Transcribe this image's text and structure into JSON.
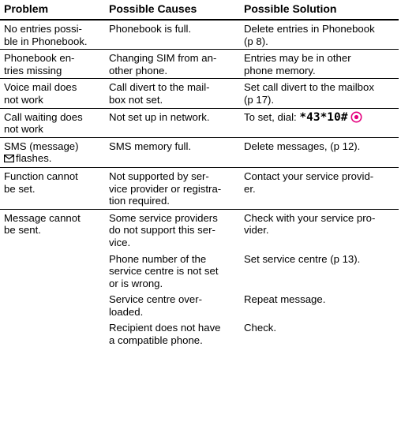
{
  "headers": {
    "problem": "Problem",
    "causes": "Possible Causes",
    "solution": "Possible Solution"
  },
  "rows": [
    {
      "problem": "No entries possi-\nble in Phonebook.",
      "cause": "Phonebook is full.",
      "solution": "Delete entries in Phonebook\n(p 8)."
    },
    {
      "problem": "Phonebook en-\ntries missing",
      "cause": "Changing SIM from an-\nother phone.",
      "solution": "Entries may be in other\nphone memory."
    },
    {
      "problem": "Voice mail does\nnot work",
      "cause": "Call divert to the mail-\nbox not set.",
      "solution": "Set call divert to the mailbox\n(p 17)."
    },
    {
      "problem": "Call waiting does\nnot work",
      "cause": "Not set up in network.",
      "solution_prefix": "To set, dial: ",
      "solution_code": "*43*10#",
      "solution_icon": "ok-key-icon"
    },
    {
      "problem_line1": "SMS (message)",
      "problem_icon": "envelope-icon",
      "problem_line2": "flashes.",
      "cause": "SMS memory full.",
      "solution": "Delete messages, (p 12)."
    },
    {
      "problem": "Function cannot\nbe set.",
      "cause": "Not supported by ser-\nvice provider or registra-\ntion required.",
      "solution": "Contact your service provid-\ner."
    },
    {
      "problem": "Message cannot\nbe sent.",
      "cause": "Some service providers\ndo not support this ser-\nvice.",
      "solution": "Check with your service pro-\nvider."
    },
    {
      "problem": "",
      "cause": "Phone number of the\nservice centre is not set\nor is wrong.",
      "solution": "Set service centre (p 13)."
    },
    {
      "problem": "",
      "cause": "Service centre over-\nloaded.",
      "solution": "Repeat message."
    },
    {
      "problem": "",
      "cause": "Recipient does not have\na compatible phone.",
      "solution": "Check."
    }
  ],
  "colors": {
    "text": "#000000",
    "rule": "#000000",
    "ok_icon": "#e4007e"
  }
}
